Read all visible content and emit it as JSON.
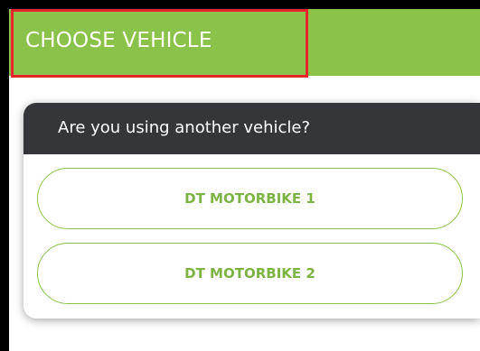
{
  "header": {
    "title": "CHOOSE VEHICLE"
  },
  "dialog": {
    "title": "Are you using another vehicle?",
    "options": [
      {
        "label": "DT MOTORBIKE 1"
      },
      {
        "label": "DT MOTORBIKE 2"
      }
    ]
  },
  "colors": {
    "header_green": "#8bc34a",
    "dialog_header": "#35363a",
    "highlight_red": "#e8242c",
    "option_text": "#7cb342"
  }
}
